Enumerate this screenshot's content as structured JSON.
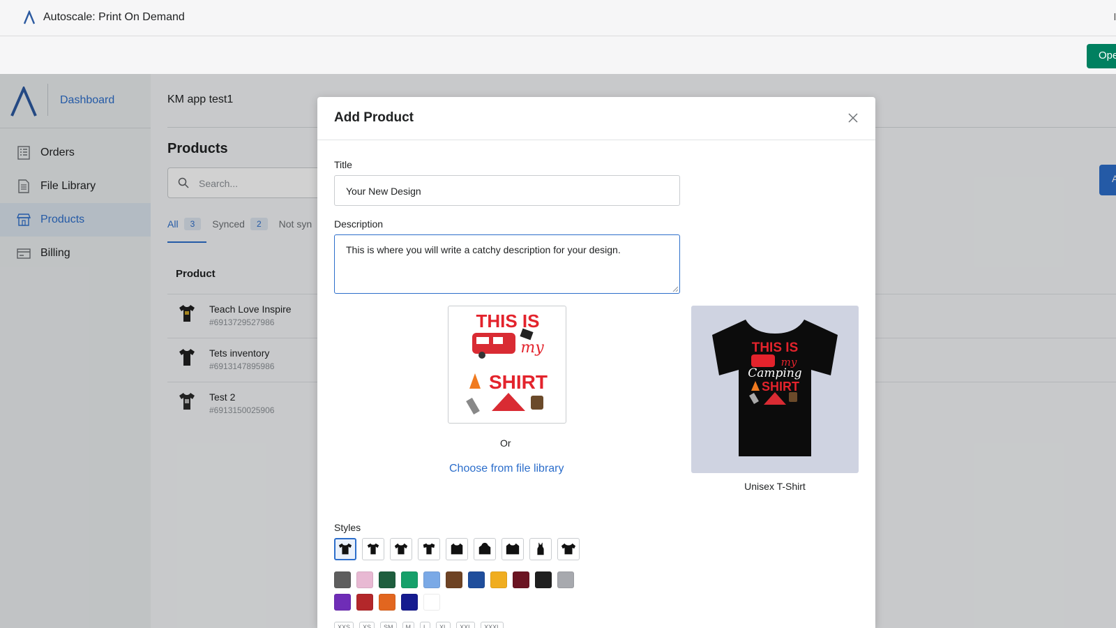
{
  "host": {
    "app_title": "Autoscale: Print On Demand",
    "edge_text": "l",
    "open_button": "Ope"
  },
  "sidebar": {
    "dashboard_label": "Dashboard",
    "items": [
      {
        "label": "Orders",
        "icon": "orders-icon"
      },
      {
        "label": "File Library",
        "icon": "file-icon"
      },
      {
        "label": "Products",
        "icon": "store-icon",
        "active": true
      },
      {
        "label": "Billing",
        "icon": "billing-icon"
      }
    ]
  },
  "main": {
    "store_name": "KM app test1",
    "page_title": "Products",
    "search_placeholder": "Search...",
    "right_button": "A",
    "tabs": [
      {
        "label": "All",
        "count": "3"
      },
      {
        "label": "Synced",
        "count": "2"
      },
      {
        "label": "Not syn",
        "count": ""
      }
    ],
    "product_column": "Product",
    "products": [
      {
        "name": "Teach Love Inspire",
        "sku": "#6913729527986"
      },
      {
        "name": "Tets inventory",
        "sku": "#6913147895986"
      },
      {
        "name": "Test 2",
        "sku": "#6913150025906"
      }
    ]
  },
  "modal": {
    "title": "Add Product",
    "title_label": "Title",
    "title_value": "Your New Design",
    "description_label": "Description",
    "description_value": "This is where you will write a catchy description for your design.",
    "or_text": "Or",
    "choose_link": "Choose from file library",
    "preview_caption": "Unisex T-Shirt",
    "design_text": {
      "line1": "THIS IS",
      "line2": "my",
      "line3": "Camping",
      "line4": "SHIRT"
    },
    "styles_label": "Styles",
    "style_count": 9,
    "colors": [
      "#5e5e5e",
      "#e8b9d3",
      "#1e5e3e",
      "#16a06a",
      "#7aa9e6",
      "#6e4324",
      "#1f4e9c",
      "#f0ad1f",
      "#6b1422",
      "#1f1f1f",
      "#a7a9ae",
      "#6f2db7",
      "#b3272a",
      "#e2661f",
      "#151b8f",
      "#ffffff"
    ],
    "sizes": [
      "XXS",
      "XS",
      "SM",
      "M",
      "L",
      "XL",
      "XXL",
      "XXXL"
    ]
  }
}
